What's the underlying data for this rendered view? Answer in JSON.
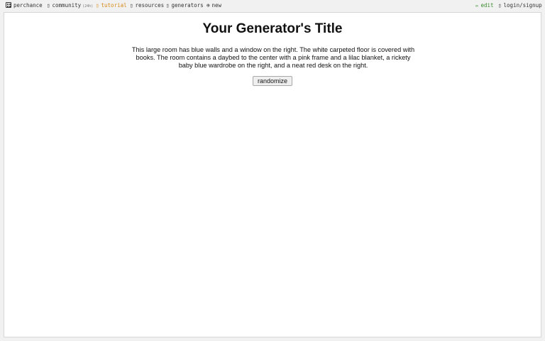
{
  "nav": {
    "brand": "perchance",
    "community_label": "community",
    "community_badge": "(24h)",
    "tutorial_label": "tutorial",
    "resources_label": "resources",
    "generators_label": "generators",
    "new_label": "new",
    "edit_label": "edit",
    "login_label": "login/signup"
  },
  "icons": {
    "brand": "dice-icon",
    "community": "chat-icon",
    "tutorial": "book-icon",
    "resources": "link-icon",
    "generators": "grid-icon",
    "new": "plus-circle-icon",
    "edit": "pencil-icon",
    "login": "user-icon"
  },
  "colors": {
    "tutorial": "#d88a1a",
    "edit": "#3a8a2e"
  },
  "generator": {
    "title": "Your Generator's Title",
    "output": "This large room has blue walls and a window on the right. The white carpeted floor is covered with books. The room contains a daybed to the center with a pink frame and a lilac blanket, a rickety baby blue wardrobe on the right, and a neat red desk on the right.",
    "button_label": "randomize"
  }
}
